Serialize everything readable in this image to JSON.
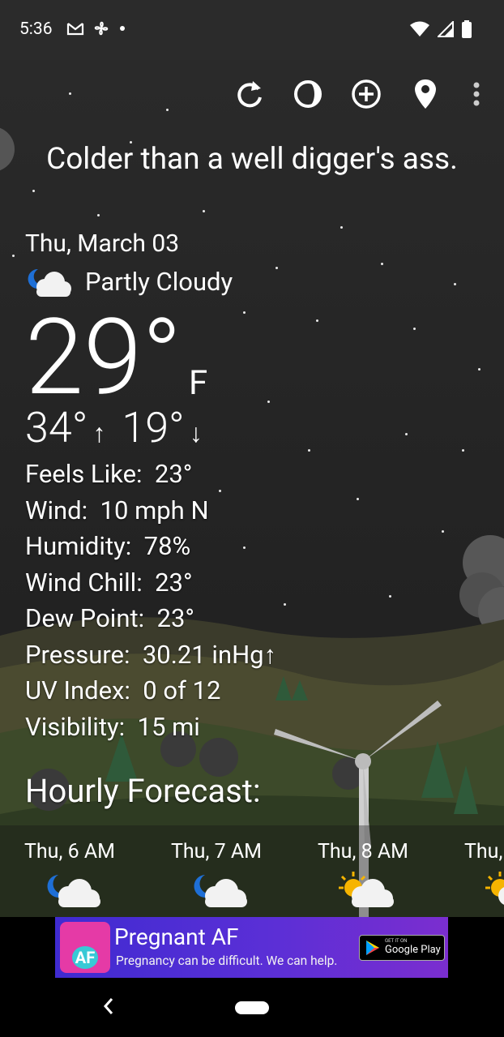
{
  "status": {
    "time": "5:36",
    "left_icons": [
      "gmail-icon",
      "fan-icon",
      "dot-icon"
    ],
    "right_icons": [
      "wifi-icon",
      "signal-icon",
      "battery-icon"
    ]
  },
  "toolbar": {
    "icons": [
      "refresh-icon",
      "theme-icon",
      "add-icon",
      "location-icon",
      "more-icon"
    ]
  },
  "quote": "Colder than a well digger's ass.",
  "current": {
    "date": "Thu, March 03",
    "condition": "Partly Cloudy",
    "condition_icon": "partly-cloudy-night-icon",
    "temperature": "29°",
    "unit": "F",
    "high": "34°",
    "low": "19°",
    "up_arrow": "↑",
    "down_arrow": "↓"
  },
  "details": [
    {
      "label": "Feels Like:",
      "value": "23°"
    },
    {
      "label": "Wind:",
      "value": "10 mph N"
    },
    {
      "label": "Humidity:",
      "value": "78%"
    },
    {
      "label": "Wind Chill:",
      "value": "23°"
    },
    {
      "label": "Dew Point:",
      "value": "23°"
    },
    {
      "label": "Pressure:",
      "value": "30.21 inHg↑"
    },
    {
      "label": "UV Index:",
      "value": "0 of 12"
    },
    {
      "label": "Visibility:",
      "value": "15 mi"
    }
  ],
  "hourly": {
    "title": "Hourly Forecast:",
    "items": [
      {
        "time": "Thu, 6 AM",
        "icon": "partly-cloudy-night-icon"
      },
      {
        "time": "Thu, 7 AM",
        "icon": "partly-cloudy-night-icon"
      },
      {
        "time": "Thu, 8 AM",
        "icon": "partly-sunny-icon"
      },
      {
        "time": "Thu,",
        "icon": "partly-sunny-icon"
      }
    ]
  },
  "ad": {
    "title": "Pregnant AF",
    "subtitle": "Pregnancy can be difficult. We can help.",
    "logo_text": "AF",
    "badge_small": "GET IT ON",
    "badge_big": "Google Play"
  },
  "colors": {
    "sky": "#242424",
    "ad_bg": "#4b2fd4",
    "ad_logo": "#e53aa6"
  }
}
